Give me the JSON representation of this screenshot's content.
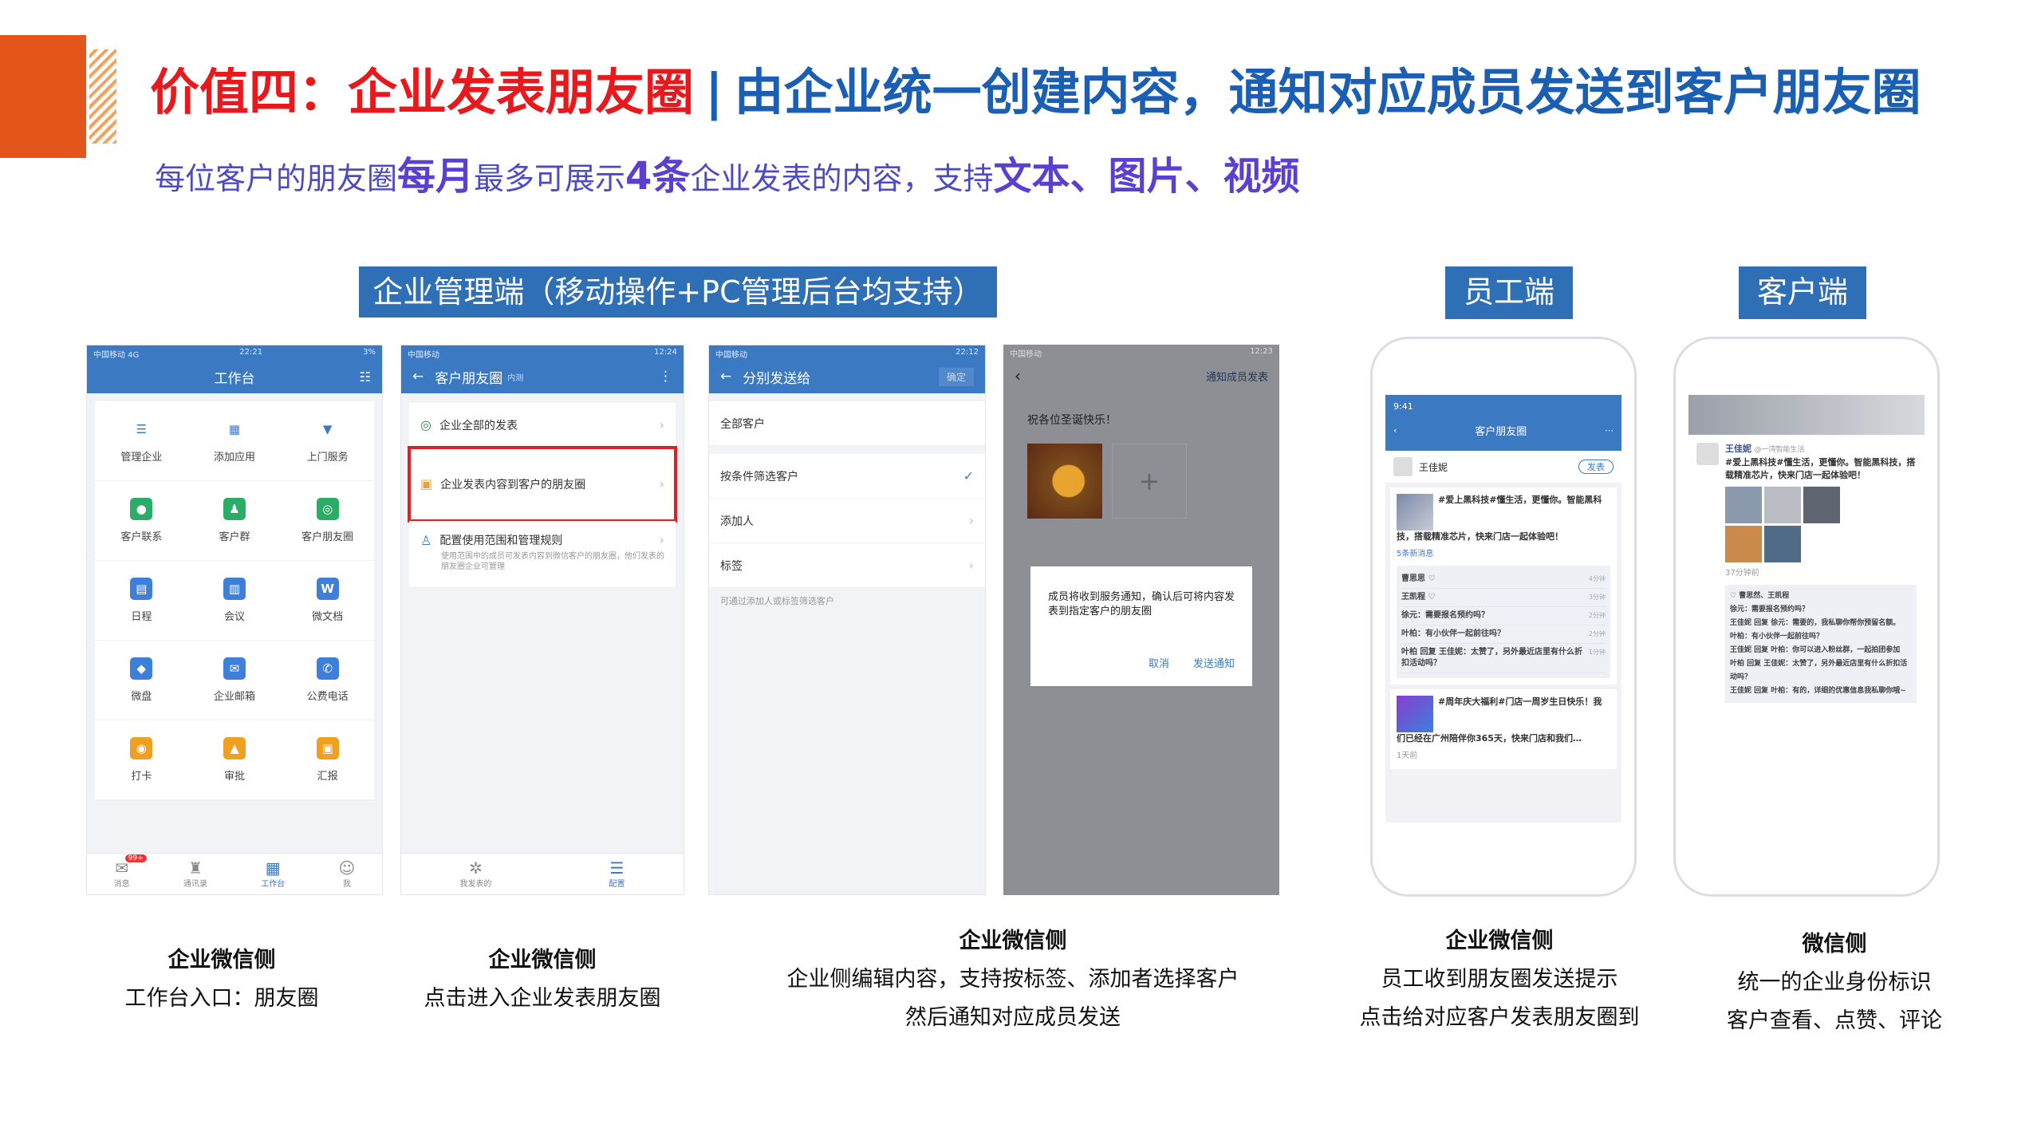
{
  "header": {
    "title_part1": "价值四：企业发表朋友圈",
    "separator": "|",
    "title_part2": "由企业统一创建内容，通知对应成员发送到客户朋友圈",
    "subtitle": {
      "s1": "每位客户的朋友圈",
      "b1": "每月",
      "s2": "最多可展示",
      "b2": "4条",
      "s3": "企业发表的内容，支持",
      "b3": "文本、图片、视频"
    }
  },
  "labels": {
    "admin": "企业管理端（移动操作+PC管理后台均支持）",
    "employee": "员工端",
    "customer": "客户端"
  },
  "phone1": {
    "status_left": "中国移动  4G",
    "status_time": "22:21",
    "status_right": "3%",
    "title": "工作台",
    "grid": [
      {
        "label": "管理企业",
        "icon": "sliders-icon",
        "color": "#ffffff",
        "glyph": "☰"
      },
      {
        "label": "添加应用",
        "icon": "grid-add-icon",
        "color": "#ffffff",
        "glyph": "▦"
      },
      {
        "label": "上门服务",
        "icon": "tie-icon",
        "color": "#ffffff",
        "glyph": "▼"
      },
      {
        "label": "客户联系",
        "icon": "chat-icon",
        "color": "#2aae67",
        "glyph": "●"
      },
      {
        "label": "客户群",
        "icon": "group-icon",
        "color": "#2aae67",
        "glyph": "♟"
      },
      {
        "label": "客户朋友圈",
        "icon": "moments-icon",
        "color": "#2aae67",
        "glyph": "◎"
      },
      {
        "label": "日程",
        "icon": "calendar-icon",
        "color": "#3d7fd9",
        "glyph": "▤"
      },
      {
        "label": "会议",
        "icon": "meeting-icon",
        "color": "#3d7fd9",
        "glyph": "▥"
      },
      {
        "label": "微文档",
        "icon": "doc-icon",
        "color": "#3d7fd9",
        "glyph": "W"
      },
      {
        "label": "微盘",
        "icon": "drive-icon",
        "color": "#3d7fd9",
        "glyph": "◆"
      },
      {
        "label": "企业邮箱",
        "icon": "mail-icon",
        "color": "#3d7fd9",
        "glyph": "✉"
      },
      {
        "label": "公费电话",
        "icon": "phone-icon",
        "color": "#3d7fd9",
        "glyph": "✆"
      },
      {
        "label": "打卡",
        "icon": "location-icon",
        "color": "#f0a020",
        "glyph": "◉"
      },
      {
        "label": "审批",
        "icon": "approve-icon",
        "color": "#f0a020",
        "glyph": "▲"
      },
      {
        "label": "汇报",
        "icon": "report-icon",
        "color": "#f0a020",
        "glyph": "▣"
      }
    ],
    "tabs": [
      "消息",
      "通讯录",
      "工作台",
      "我"
    ],
    "badge": "99+"
  },
  "phone2": {
    "status_left": "中国移动",
    "status_time": "12:24",
    "title": "客户朋友圈",
    "title_small": "内测",
    "rows": [
      "企业全部的发表",
      "企业发表内容到客户的朋友圈",
      "配置使用范围和管理规则"
    ],
    "desc": "使用范围中的成员可发表内容到微信客户的朋友圈，他们发表的朋友圈企业可管理",
    "tabs": [
      "我发表的",
      "配置"
    ]
  },
  "phone3": {
    "status_left": "中国移动",
    "status_time": "22:12",
    "title": "分别发送给",
    "btn": "确定",
    "rows": [
      "全部客户",
      "按条件筛选客户",
      "添加人",
      "标签"
    ],
    "hint": "可通过添加人或标签筛选客户"
  },
  "phone4": {
    "status_left": "中国移动",
    "status_time": "12:23",
    "nav_right": "通知成员发表",
    "text": "祝各位圣诞快乐！",
    "dialog": "成员将收到服务通知，确认后可将内容发表到指定客户的朋友圈",
    "cancel": "取消",
    "confirm": "发送通知"
  },
  "phone5": {
    "time": "9:41",
    "title": "客户朋友圈",
    "user": "王佳妮",
    "btn": "发表",
    "post1_tag": "#爱上黑科技#",
    "post1": "懂生活，更懂你。智能黑科技，搭载精准芯片，快来门店一起体验吧！",
    "post1_meta": "5条新消息",
    "comments": [
      {
        "t": "曹思思 ♡",
        "time": "4分钟"
      },
      {
        "t": "王凯程 ♡",
        "time": "3分钟"
      },
      {
        "t": "徐元：需要报名预约吗？",
        "time": "2分钟"
      },
      {
        "t": "叶柏：有小伙伴一起前往吗？",
        "time": "2分钟"
      },
      {
        "t": "叶柏 回复 王佳妮：太赞了，另外最近店里有什么折扣活动吗？",
        "time": "1分钟"
      }
    ],
    "post2_tag": "#周年庆大福利#",
    "post2": "门店一周岁生日快乐！我们已经在广州陪伴你365天，快来门店和我们…",
    "post2_meta": "1天前"
  },
  "phone6": {
    "user": "王佳妮",
    "org": "@一湾智能生活",
    "post_tag": "#爱上黑科技#",
    "post": "懂生活，更懂你。智能黑科技，搭载精准芯片，快来门店一起体验吧！",
    "time": "37分钟前",
    "comments": [
      "♡ 曹思然、王凯程",
      "徐元：需要报名预约吗？",
      "王佳妮 回复 徐元：需要的，我私聊你帮你预留名额。",
      "叶柏：有小伙伴一起前往吗？",
      "王佳妮 回复 叶柏：你可以进入粉丝群，一起拍团参加",
      "叶柏 回复 王佳妮：太赞了，另外最近店里有什么折扣活动吗？",
      "王佳妮 回复 叶柏：有的，详细的优惠信息我私聊你哦~"
    ]
  },
  "captions": [
    {
      "head": "企业微信侧",
      "lines": [
        "工作台入口：朋友圈"
      ]
    },
    {
      "head": "企业微信侧",
      "lines": [
        "点击进入企业发表朋友圈"
      ]
    },
    {
      "head": "企业微信侧",
      "lines": [
        "企业侧编辑内容，支持按标签、添加者选择客户",
        "然后通知对应成员发送"
      ]
    },
    {
      "head": "企业微信侧",
      "lines": [
        "员工收到朋友圈发送提示",
        "点击给对应客户发表朋友圈到"
      ]
    },
    {
      "head": "微信侧",
      "lines": [
        "统一的企业身份标识",
        "客户查看、点赞、评论"
      ]
    }
  ],
  "colors": {
    "accent": "#e2561c",
    "red": "#e8191c",
    "blue": "#1a5fb4",
    "purple": "#5a3fd0",
    "label_bg": "#2f6fb6",
    "highlight": "#e02020"
  }
}
